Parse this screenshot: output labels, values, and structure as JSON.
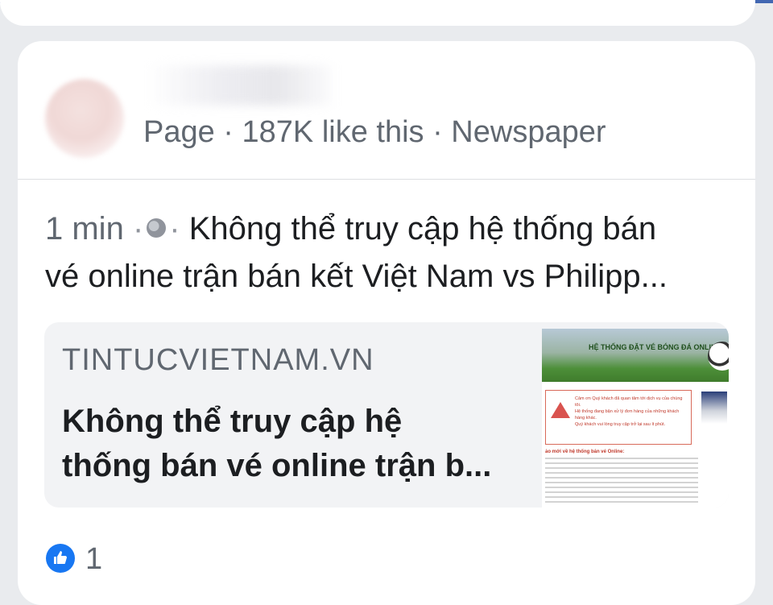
{
  "post": {
    "page_meta": "Page · 187K like this · Newspaper",
    "time": "1 min",
    "text_line1_rest": "Không thể truy cập hệ thống bán",
    "text_line2": "vé online trận bán kết Việt Nam vs Philipp..."
  },
  "link_preview": {
    "domain": "TINTUCVIETNAM.VN",
    "title_line1": "Không thể truy cập hệ",
    "title_line2": "thống bán vé online trận b...",
    "thumbnail": {
      "banner": "HỆ THỐNG ĐẶT VÉ BÓNG ĐÁ ONLINE",
      "alert_line1": "Cảm ơn Quý khách đã quan tâm tới dịch vụ của chúng tôi.",
      "alert_line2": "Hệ thống đang bận xử lý đơn hàng của những khách hàng khác.",
      "alert_line3": "Quý khách vui lòng truy cập trở lại sau ít phút.",
      "section_heading": "ảo mới về hệ thống bán vé Online:"
    }
  },
  "reactions": {
    "like_count": "1"
  },
  "colors": {
    "accent": "#1877f2",
    "text": "#1c1e21",
    "secondary": "#606770"
  }
}
